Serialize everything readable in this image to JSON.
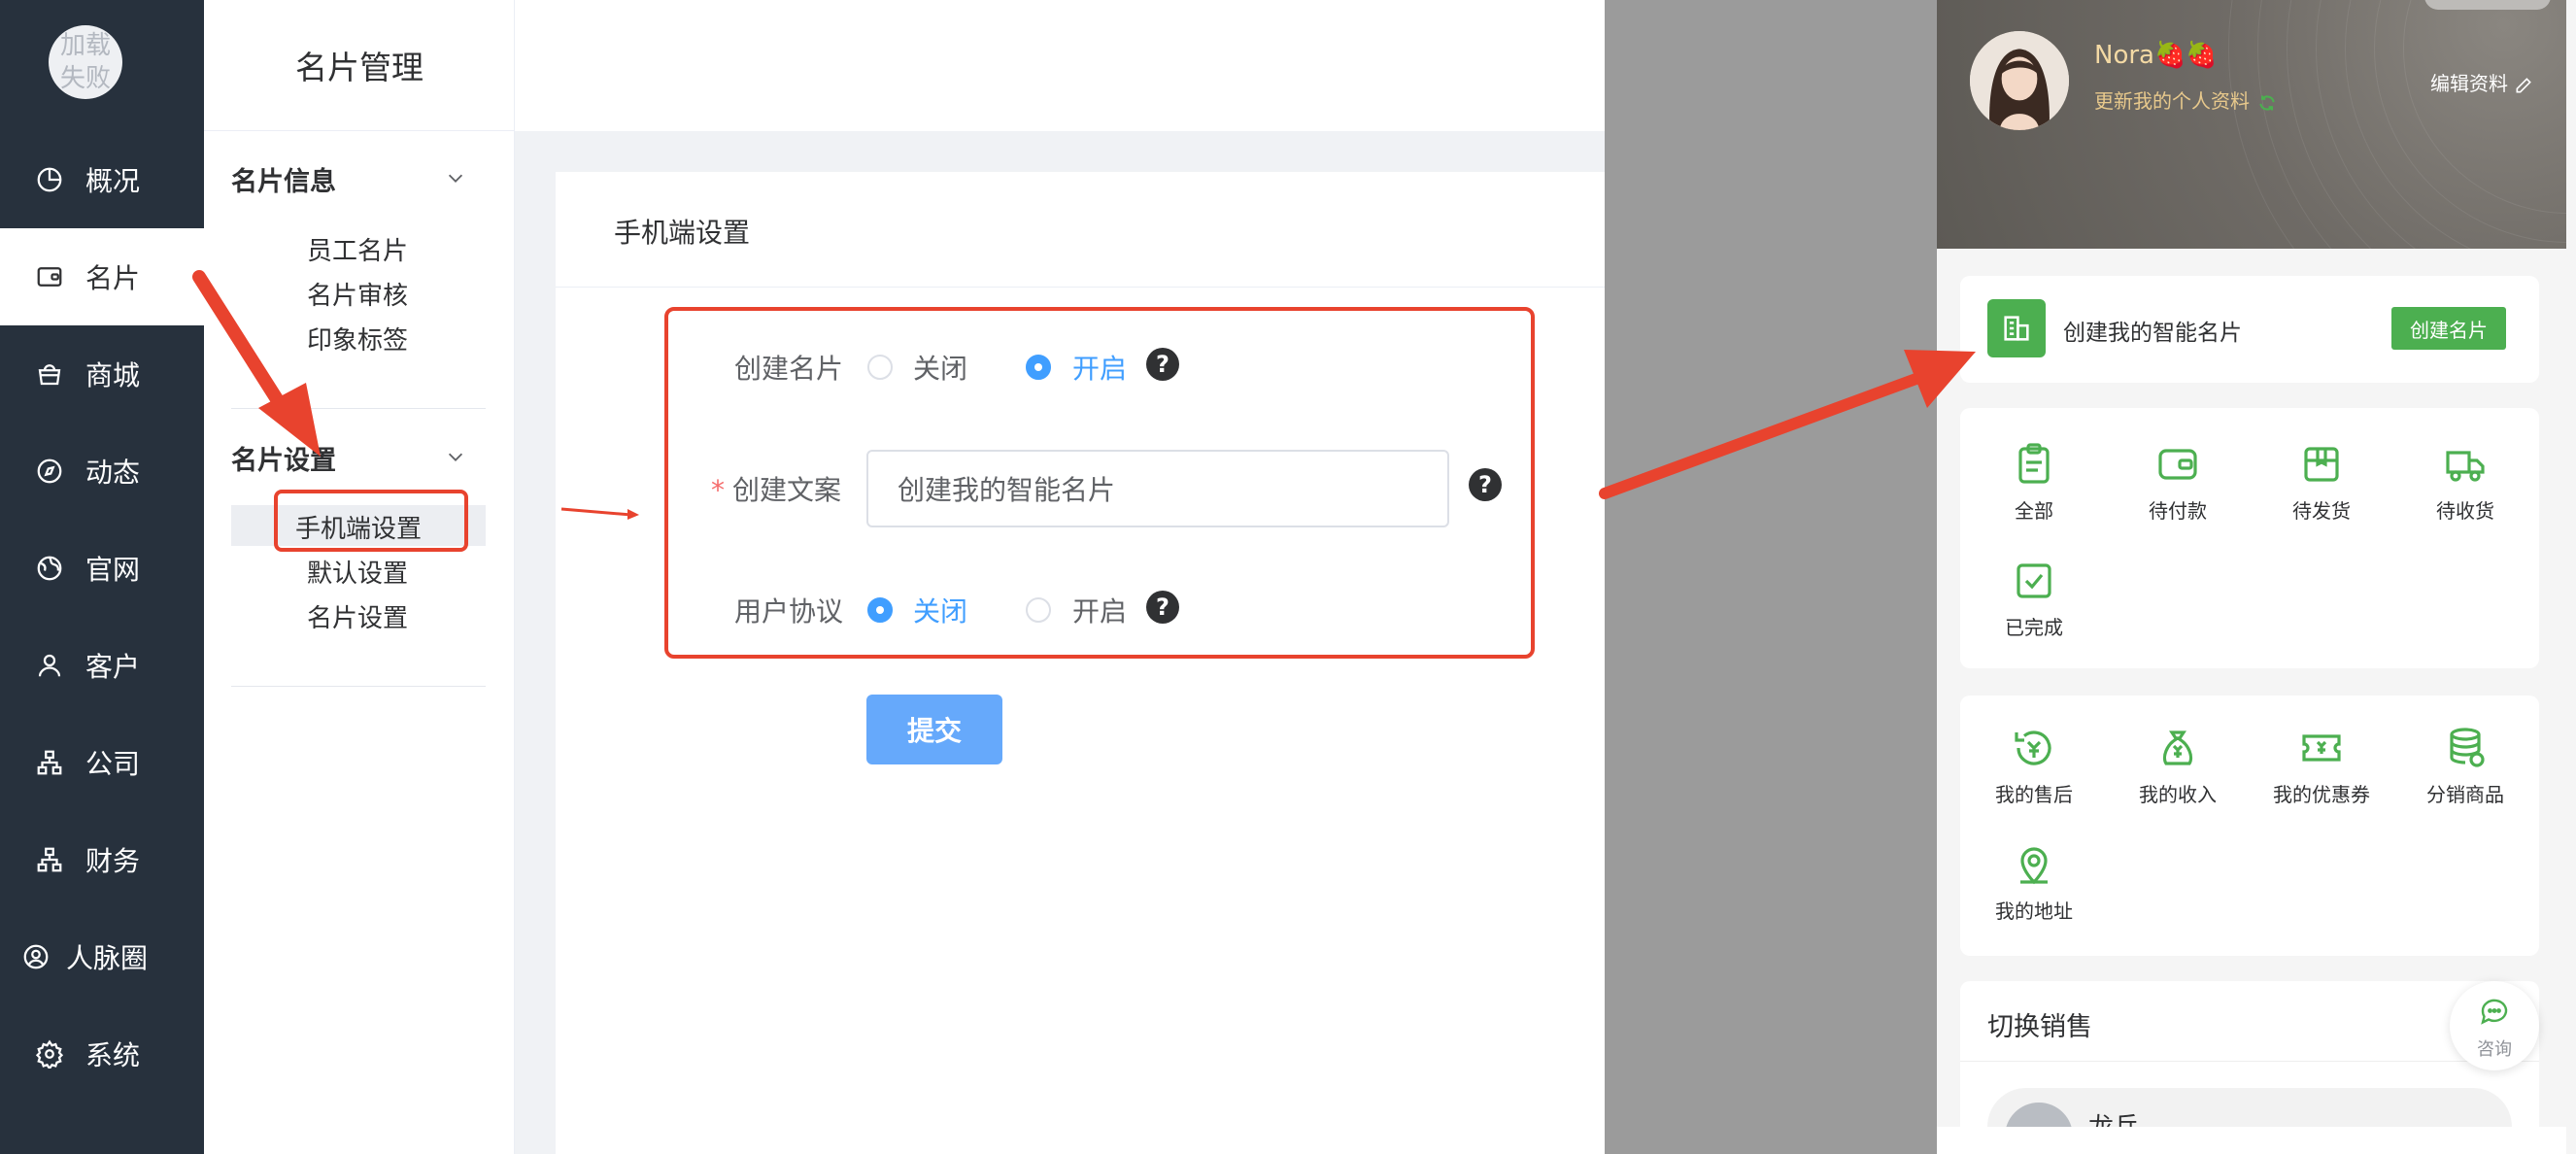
{
  "sidebar": {
    "avatar_fail_text": "加载失败",
    "items": [
      {
        "label": "概况",
        "icon": "pie-chart-icon"
      },
      {
        "label": "名片",
        "icon": "wallet-icon"
      },
      {
        "label": "商城",
        "icon": "shopping-bag-icon"
      },
      {
        "label": "动态",
        "icon": "compass-icon"
      },
      {
        "label": "官网",
        "icon": "globe-icon"
      },
      {
        "label": "客户",
        "icon": "user-icon"
      },
      {
        "label": "公司",
        "icon": "org-chart-icon"
      },
      {
        "label": "财务",
        "icon": "org-chart-icon"
      },
      {
        "label": "人脉圈",
        "icon": "user-circle-icon"
      },
      {
        "label": "系统",
        "icon": "gear-icon"
      }
    ],
    "active": "名片"
  },
  "submenu": {
    "title": "名片管理",
    "groups": [
      {
        "title": "名片信息",
        "items": [
          "员工名片",
          "名片审核",
          "印象标签"
        ]
      },
      {
        "title": "名片设置",
        "items": [
          "手机端设置",
          "默认设置",
          "名片设置"
        ]
      }
    ],
    "active_item": "手机端设置"
  },
  "form": {
    "card_title": "手机端设置",
    "rows": {
      "create_card": {
        "label": "创建名片",
        "options": [
          "关闭",
          "开启"
        ],
        "selected": "开启"
      },
      "create_text": {
        "label": "创建文案",
        "required": "*",
        "value": "创建我的智能名片"
      },
      "user_agreement": {
        "label": "用户协议",
        "options": [
          "关闭",
          "开启"
        ],
        "selected": "关闭"
      }
    },
    "help_symbol": "?",
    "submit_label": "提交"
  },
  "phone": {
    "profile": {
      "name": "Nora🍓🍓",
      "subtitle": "更新我的个人资料",
      "edit_label": "编辑资料"
    },
    "create_card": {
      "text": "创建我的智能名片",
      "button": "创建名片"
    },
    "orders": [
      {
        "label": "全部",
        "icon": "clipboard-icon"
      },
      {
        "label": "待付款",
        "icon": "wallet-icon"
      },
      {
        "label": "待发货",
        "icon": "box-icon"
      },
      {
        "label": "待收货",
        "icon": "truck-icon"
      },
      {
        "label": "已完成",
        "icon": "check-box-icon"
      }
    ],
    "services": [
      {
        "label": "我的售后",
        "icon": "refund-icon"
      },
      {
        "label": "我的收入",
        "icon": "money-bag-icon"
      },
      {
        "label": "我的优惠券",
        "icon": "coupon-icon"
      },
      {
        "label": "分销商品",
        "icon": "coins-icon"
      },
      {
        "label": "我的地址",
        "icon": "location-icon"
      }
    ],
    "switch_sales_title": "切换销售",
    "consult_label": "咨询",
    "sales_name": "龙兵"
  },
  "colors": {
    "sidebar_bg": "#27313d",
    "accent_blue": "#409eff",
    "highlight_red": "#e8432e",
    "phone_green": "#4caf50"
  }
}
